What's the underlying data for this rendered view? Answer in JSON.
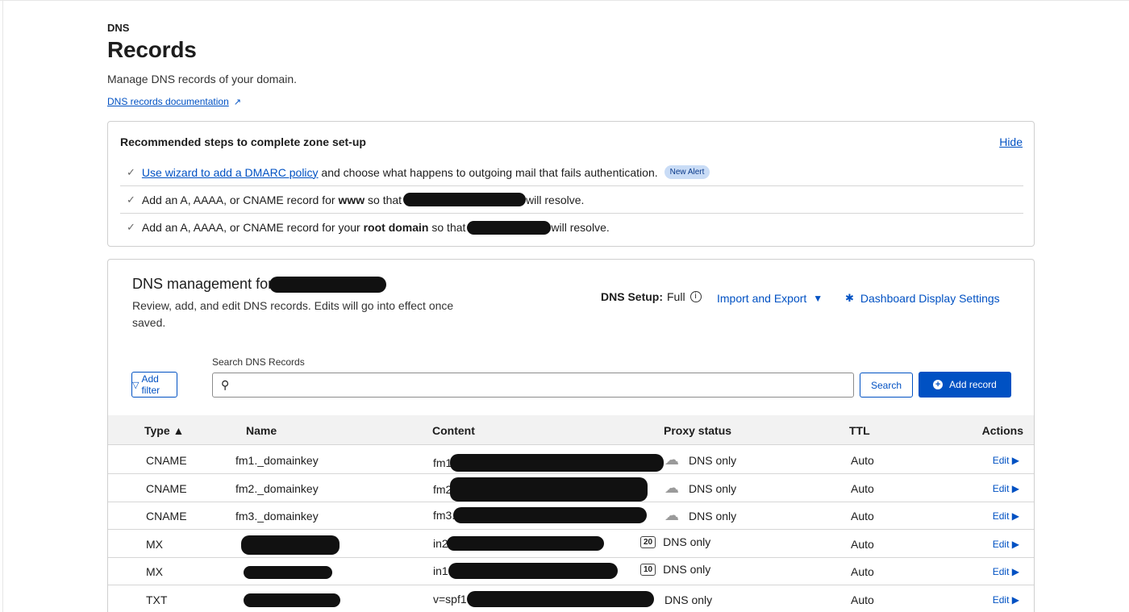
{
  "header": {
    "eyebrow": "DNS",
    "title": "Records",
    "subtitle": "Manage DNS records of your domain.",
    "doc_link": "DNS records documentation"
  },
  "recommended": {
    "title": "Recommended steps to complete zone set-up",
    "hide_label": "Hide",
    "items": [
      {
        "link": "Use wizard to add a DMARC policy",
        "text": " and choose what happens to outgoing mail that fails authentication.",
        "badge": "New Alert"
      },
      {
        "prefix": "Add an A, AAAA, or CNAME record for ",
        "bold": "www",
        "middle": " so that",
        "suffix": "will resolve."
      },
      {
        "prefix": "Add an A, AAAA, or CNAME record for your ",
        "bold": "root domain",
        "middle": " so that",
        "suffix": "will resolve."
      }
    ]
  },
  "management": {
    "title": "DNS management for",
    "description": "Review, add, and edit DNS records. Edits will go into effect once saved.",
    "setup_label": "DNS Setup:",
    "setup_value": "Full",
    "import_export": "Import and Export",
    "dashboard_settings": "Dashboard Display Settings",
    "search_label": "Search DNS Records",
    "search_placeholder": "",
    "add_filter": "Add filter",
    "search_button": "Search",
    "add_record": "Add record"
  },
  "table": {
    "headers": {
      "type": "Type ▲",
      "name": "Name",
      "content": "Content",
      "proxy": "Proxy status",
      "ttl": "TTL",
      "actions": "Actions"
    },
    "rows": [
      {
        "type": "CNAME",
        "name": "fm1._domainkey",
        "content": "fm1",
        "proxy": "DNS only",
        "ttl": "Auto",
        "edit": "Edit",
        "priority": ""
      },
      {
        "type": "CNAME",
        "name": "fm2._domainkey",
        "content": "fm2",
        "proxy": "DNS only",
        "ttl": "Auto",
        "edit": "Edit",
        "priority": ""
      },
      {
        "type": "CNAME",
        "name": "fm3._domainkey",
        "content": "fm3.",
        "proxy": "DNS only",
        "ttl": "Auto",
        "edit": "Edit",
        "priority": ""
      },
      {
        "type": "MX",
        "name": "",
        "content": "in2",
        "proxy": "DNS only",
        "ttl": "Auto",
        "edit": "Edit",
        "priority": "20"
      },
      {
        "type": "MX",
        "name": "",
        "content": "in1",
        "proxy": "DNS only",
        "ttl": "Auto",
        "edit": "Edit",
        "priority": "10"
      },
      {
        "type": "TXT",
        "name": "",
        "content": "v=spf1",
        "proxy": "DNS only",
        "ttl": "Auto",
        "edit": "Edit",
        "priority": ""
      }
    ]
  },
  "icons": {
    "external_link": "external-link-icon",
    "check": "check-icon",
    "info": "info-icon",
    "caret": "caret-down-icon",
    "gear": "gear-icon",
    "filter": "filter-icon",
    "search": "search-icon",
    "plus": "plus-circle-icon",
    "cloud": "cloud-icon"
  },
  "colors": {
    "accent": "#0051c3",
    "badge_bg": "#c9dcf6"
  }
}
